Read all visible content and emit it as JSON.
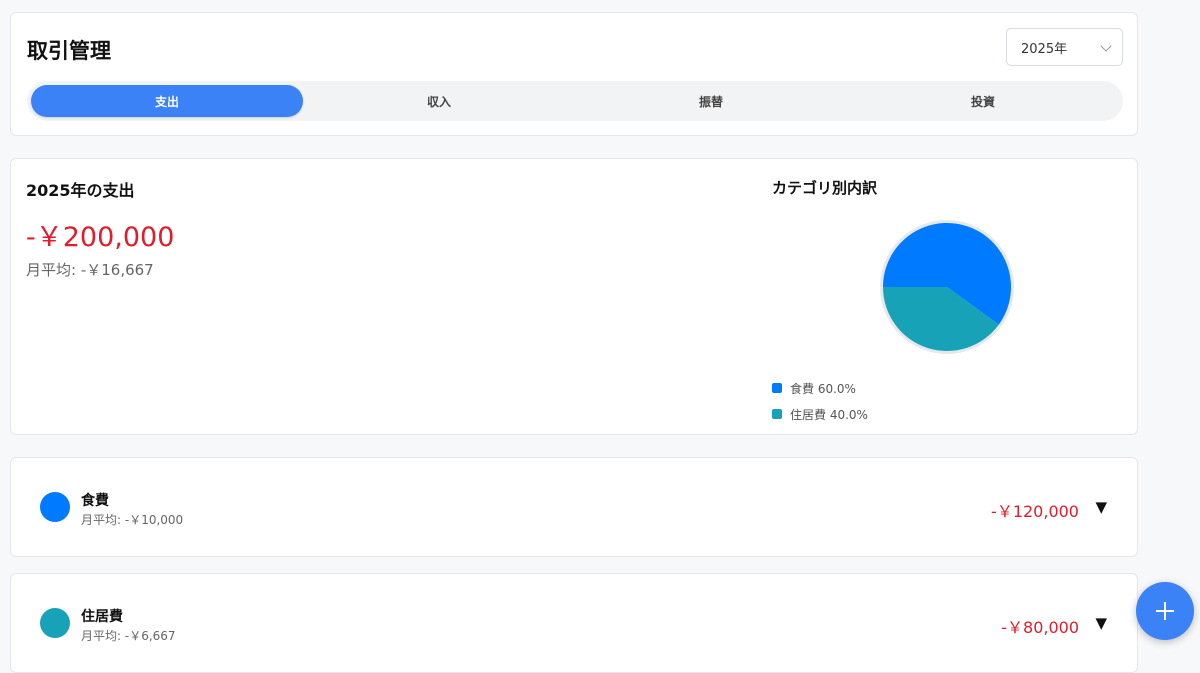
{
  "header": {
    "title": "取引管理",
    "year_select": {
      "value": "2025年"
    },
    "tabs": [
      {
        "label": "支出",
        "active": true
      },
      {
        "label": "収入",
        "active": false
      },
      {
        "label": "振替",
        "active": false
      },
      {
        "label": "投資",
        "active": false
      }
    ]
  },
  "summary": {
    "title": "2025年の支出",
    "total": "-￥200,000",
    "monthly_avg": "月平均: -￥16,667",
    "breakdown_title": "カテゴリ別内訳"
  },
  "chart_data": {
    "type": "pie",
    "categories": [
      "食費",
      "住居費"
    ],
    "values": [
      60.0,
      40.0
    ],
    "colors": [
      "#007bff",
      "#17a2b8"
    ],
    "legend_labels": [
      "食費 60.0%",
      "住居費 40.0%"
    ],
    "legend_placement": "bottom-left"
  },
  "categories": [
    {
      "name": "食費",
      "avg": "月平均: -￥10,000",
      "amount": "-￥120,000",
      "color": "#007bff",
      "toggle": "▼"
    },
    {
      "name": "住居費",
      "avg": "月平均: -￥6,667",
      "amount": "-￥80,000",
      "color": "#17a2b8",
      "toggle": "▼"
    }
  ],
  "fab": {
    "icon": "plus-icon"
  }
}
